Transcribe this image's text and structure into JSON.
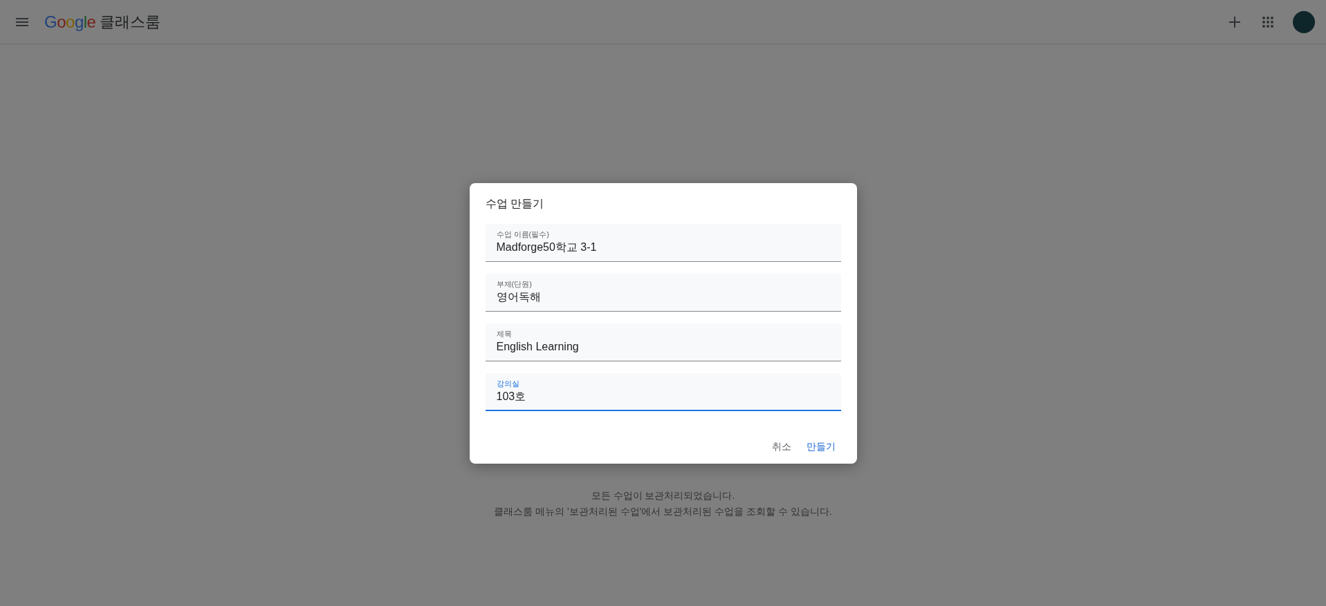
{
  "header": {
    "logo": "Google",
    "product": "클래스룸"
  },
  "empty_state": {
    "lines": [
      "모든 수업이 보관처리되었습니다.",
      "클래스룸 메뉴의 '보관처리된 수업'에서 보관처리된 수업을 조회할 수 있습니다."
    ]
  },
  "dialog": {
    "title": "수업 만들기",
    "fields": [
      {
        "label": "수업 이름(필수)",
        "value": "Madforge50학교 3-1",
        "focused": false
      },
      {
        "label": "부제(단원)",
        "value": "영어독해",
        "focused": false
      },
      {
        "label": "제목",
        "value": "English Learning",
        "focused": false
      },
      {
        "label": "강의실",
        "value": "103호",
        "focused": true
      }
    ],
    "buttons": [
      {
        "label": "취소",
        "kind": "secondary"
      },
      {
        "label": "만들기",
        "kind": "primary"
      }
    ]
  }
}
